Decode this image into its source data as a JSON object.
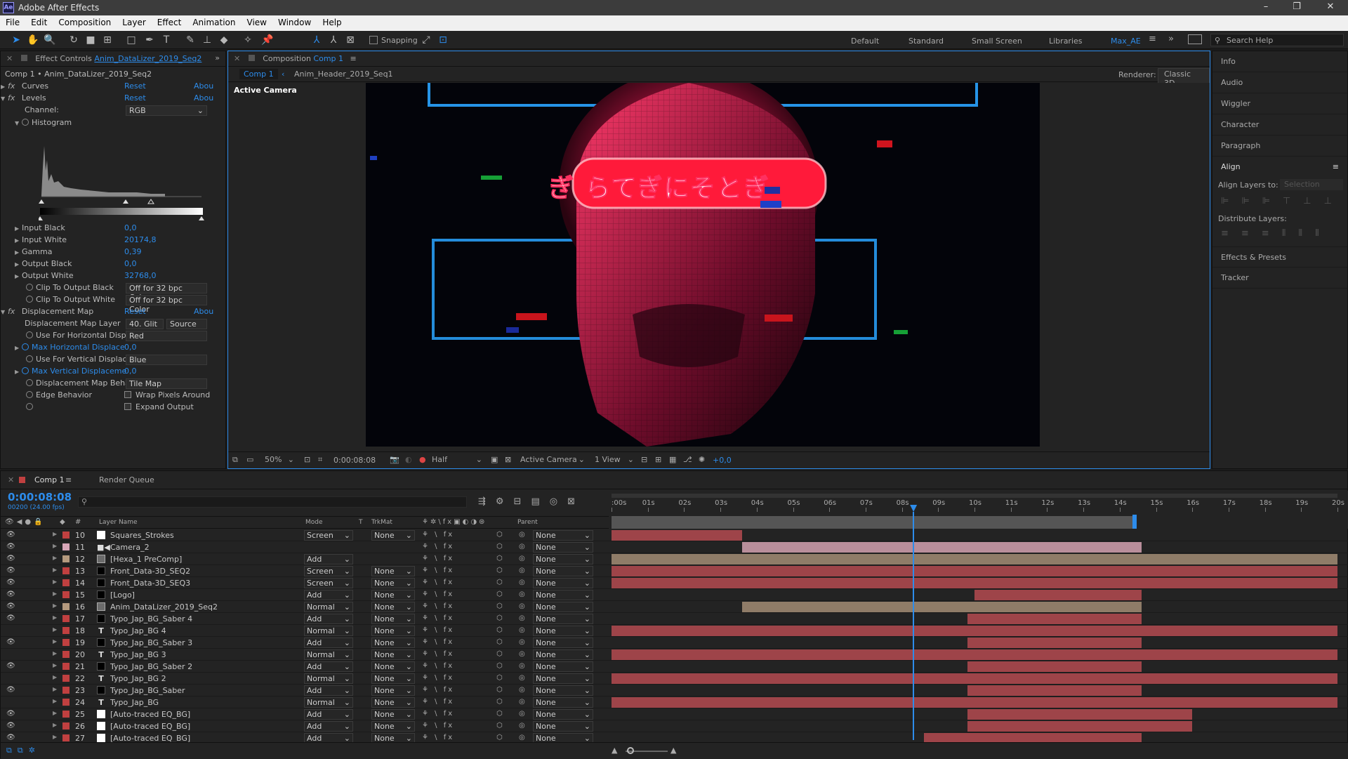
{
  "app": {
    "title": "Adobe After Effects",
    "logo": "Ae"
  },
  "menu": [
    "File",
    "Edit",
    "Composition",
    "Layer",
    "Effect",
    "Animation",
    "View",
    "Window",
    "Help"
  ],
  "toolbar": {
    "snapping": "Snapping",
    "workspaces": [
      "Default",
      "Standard",
      "Small Screen",
      "Libraries",
      "Max_AE"
    ],
    "search_placeholder": "Search Help"
  },
  "effect_controls": {
    "tab_prefix": "Effect Controls",
    "tab_layer": "Anim_DataLizer_2019_Seq2",
    "breadcrumb": "Comp 1 • Anim_DataLizer_2019_Seq2",
    "effects": [
      {
        "name": "Curves",
        "reset": "Reset",
        "about": "Abou"
      },
      {
        "name": "Levels",
        "reset": "Reset",
        "about": "Abou"
      }
    ],
    "channel_label": "Channel:",
    "channel_value": "RGB",
    "histogram_label": "Histogram",
    "props": [
      {
        "label": "Input Black",
        "value": "0,0"
      },
      {
        "label": "Input White",
        "value": "20174,8"
      },
      {
        "label": "Gamma",
        "value": "0,39"
      },
      {
        "label": "Output Black",
        "value": "0,0"
      },
      {
        "label": "Output White",
        "value": "32768,0"
      }
    ],
    "clip_black_label": "Clip To Output Black",
    "clip_black_value": "Off for 32 bpc Color",
    "clip_white_label": "Clip To Output White",
    "clip_white_value": "Off for 32 bpc Color",
    "disp_name": "Displacement Map",
    "disp_reset": "Reset",
    "disp_about": "Abou",
    "disp_layer_label": "Displacement Map Layer",
    "disp_layer_value": "40. Glit",
    "disp_source": "Source",
    "use_h_label": "Use For Horizontal Displ",
    "use_h_value": "Red",
    "max_h_label": "Max Horizontal Displace",
    "max_h_value": "0,0",
    "use_v_label": "Use For Vertical Displac",
    "use_v_value": "Blue",
    "max_v_label": "Max Vertical Displaceme",
    "max_v_value": "0,0",
    "behavior_label": "Displacement Map Beha",
    "behavior_value": "Tile Map",
    "edge_label": "Edge Behavior",
    "wrap_label": "Wrap Pixels Around",
    "expand_label": "Expand Output"
  },
  "composition": {
    "tab_label": "Composition",
    "tab_comp": "Comp 1",
    "nav_comp": "Comp 1",
    "nav_next": "Anim_Header_2019_Seq1",
    "renderer_label": "Renderer:",
    "renderer_value": "Classic 3D",
    "view_label": "Active Camera",
    "overlay_text": "ぎ らてぎにそとぎ",
    "footer": {
      "zoom": "50%",
      "timecode": "0:00:08:08",
      "resolution": "Half",
      "camera": "Active Camera",
      "views": "1 View",
      "exposure": "+0,0"
    }
  },
  "right_panel": {
    "items": [
      "Info",
      "Audio",
      "Wiggler",
      "Character",
      "Paragraph"
    ],
    "align": "Align",
    "align_layers_to": "Align Layers to:",
    "selection": "Selection",
    "distribute": "Distribute Layers:",
    "items2": [
      "Effects & Presets",
      "Tracker"
    ]
  },
  "timeline": {
    "tab_comp": "Comp 1",
    "tab_render": "Render Queue",
    "timecode": "0:00:08:08",
    "fps": "00200 (24.00 fps)",
    "headers": {
      "num": "#",
      "name": "Layer Name",
      "mode": "Mode",
      "t": "T",
      "trkmat": "TrkMat",
      "parent": "Parent"
    },
    "ruler": [
      ":00s",
      "01s",
      "02s",
      "03s",
      "04s",
      "05s",
      "06s",
      "07s",
      "08s",
      "09s",
      "10s",
      "11s",
      "12s",
      "13s",
      "14s",
      "15s",
      "16s",
      "17s",
      "18s",
      "19s",
      "20s"
    ],
    "layers": [
      {
        "num": "10",
        "name": "Squares_Strokes",
        "mode": "Screen",
        "trk": "None",
        "parent": "None",
        "color": "#c04040",
        "icon": "solid",
        "start": 0.0,
        "end": 0.18,
        "bar": "#9e4449"
      },
      {
        "num": "11",
        "name": "Camera_2",
        "mode": "",
        "trk": "",
        "parent": "None",
        "color": "#d8a6b8",
        "icon": "camera",
        "start": 0.18,
        "end": 0.73,
        "bar": "#b98e9b"
      },
      {
        "num": "12",
        "name": "[Hexa_1 PreComp]",
        "mode": "Add",
        "trk": "",
        "parent": "None",
        "color": "#b59a7e",
        "icon": "precomp",
        "start": 0.0,
        "end": 1.0,
        "bar": "#8f7c68"
      },
      {
        "num": "13",
        "name": "Front_Data-3D_SEQ2",
        "mode": "Screen",
        "trk": "None",
        "parent": "None",
        "color": "#c04040",
        "icon": "black",
        "start": 0.0,
        "end": 1.0,
        "bar": "#9e4449"
      },
      {
        "num": "14",
        "name": "Front_Data-3D_SEQ3",
        "mode": "Screen",
        "trk": "None",
        "parent": "None",
        "color": "#c04040",
        "icon": "black",
        "start": 0.0,
        "end": 1.0,
        "bar": "#9e4449"
      },
      {
        "num": "15",
        "name": "[Logo]",
        "mode": "Add",
        "trk": "None",
        "parent": "None",
        "color": "#c04040",
        "icon": "black",
        "start": 0.5,
        "end": 0.73,
        "bar": "#9e4449"
      },
      {
        "num": "16",
        "name": "Anim_DataLizer_2019_Seq2",
        "mode": "Normal",
        "trk": "None",
        "parent": "None",
        "color": "#b59a7e",
        "icon": "precomp",
        "start": 0.18,
        "end": 0.73,
        "bar": "#8f7c68"
      },
      {
        "num": "17",
        "name": "Typo_Jap_BG_Saber 4",
        "mode": "Add",
        "trk": "None",
        "parent": "None",
        "color": "#c04040",
        "icon": "black",
        "start": 0.49,
        "end": 0.73,
        "bar": "#9e4449"
      },
      {
        "num": "18",
        "name": "Typo_Jap_BG 4",
        "mode": "Normal",
        "trk": "None",
        "parent": "None",
        "color": "#c04040",
        "icon": "text",
        "start": 0.0,
        "end": 1.0,
        "bar": "#9e4449"
      },
      {
        "num": "19",
        "name": "Typo_Jap_BG_Saber 3",
        "mode": "Add",
        "trk": "None",
        "parent": "None",
        "color": "#c04040",
        "icon": "black",
        "start": 0.49,
        "end": 0.73,
        "bar": "#9e4449"
      },
      {
        "num": "20",
        "name": "Typo_Jap_BG 3",
        "mode": "Normal",
        "trk": "None",
        "parent": "None",
        "color": "#c04040",
        "icon": "text",
        "start": 0.0,
        "end": 1.0,
        "bar": "#9e4449"
      },
      {
        "num": "21",
        "name": "Typo_Jap_BG_Saber 2",
        "mode": "Add",
        "trk": "None",
        "parent": "None",
        "color": "#c04040",
        "icon": "black",
        "start": 0.49,
        "end": 0.73,
        "bar": "#9e4449"
      },
      {
        "num": "22",
        "name": "Typo_Jap_BG 2",
        "mode": "Normal",
        "trk": "None",
        "parent": "None",
        "color": "#c04040",
        "icon": "text",
        "start": 0.0,
        "end": 1.0,
        "bar": "#9e4449"
      },
      {
        "num": "23",
        "name": "Typo_Jap_BG_Saber",
        "mode": "Add",
        "trk": "None",
        "parent": "None",
        "color": "#c04040",
        "icon": "black",
        "start": 0.49,
        "end": 0.73,
        "bar": "#9e4449"
      },
      {
        "num": "24",
        "name": "Typo_Jap_BG",
        "mode": "Normal",
        "trk": "None",
        "parent": "None",
        "color": "#c04040",
        "icon": "text",
        "start": 0.0,
        "end": 1.0,
        "bar": "#9e4449"
      },
      {
        "num": "25",
        "name": "[Auto-traced EQ_BG]",
        "mode": "Add",
        "trk": "None",
        "parent": "None",
        "color": "#c04040",
        "icon": "white",
        "start": 0.49,
        "end": 0.8,
        "bar": "#9e4449"
      },
      {
        "num": "26",
        "name": "[Auto-traced EQ_BG]",
        "mode": "Add",
        "trk": "None",
        "parent": "None",
        "color": "#c04040",
        "icon": "white",
        "start": 0.49,
        "end": 0.8,
        "bar": "#9e4449"
      },
      {
        "num": "27",
        "name": "[Auto-traced EQ_BG]",
        "mode": "Add",
        "trk": "None",
        "parent": "None",
        "color": "#c04040",
        "icon": "white",
        "start": 0.43,
        "end": 0.73,
        "bar": "#9e4449"
      }
    ],
    "playhead_fraction": 0.415
  },
  "colors": {
    "accent": "#2d8ceb",
    "panel": "#232323"
  }
}
